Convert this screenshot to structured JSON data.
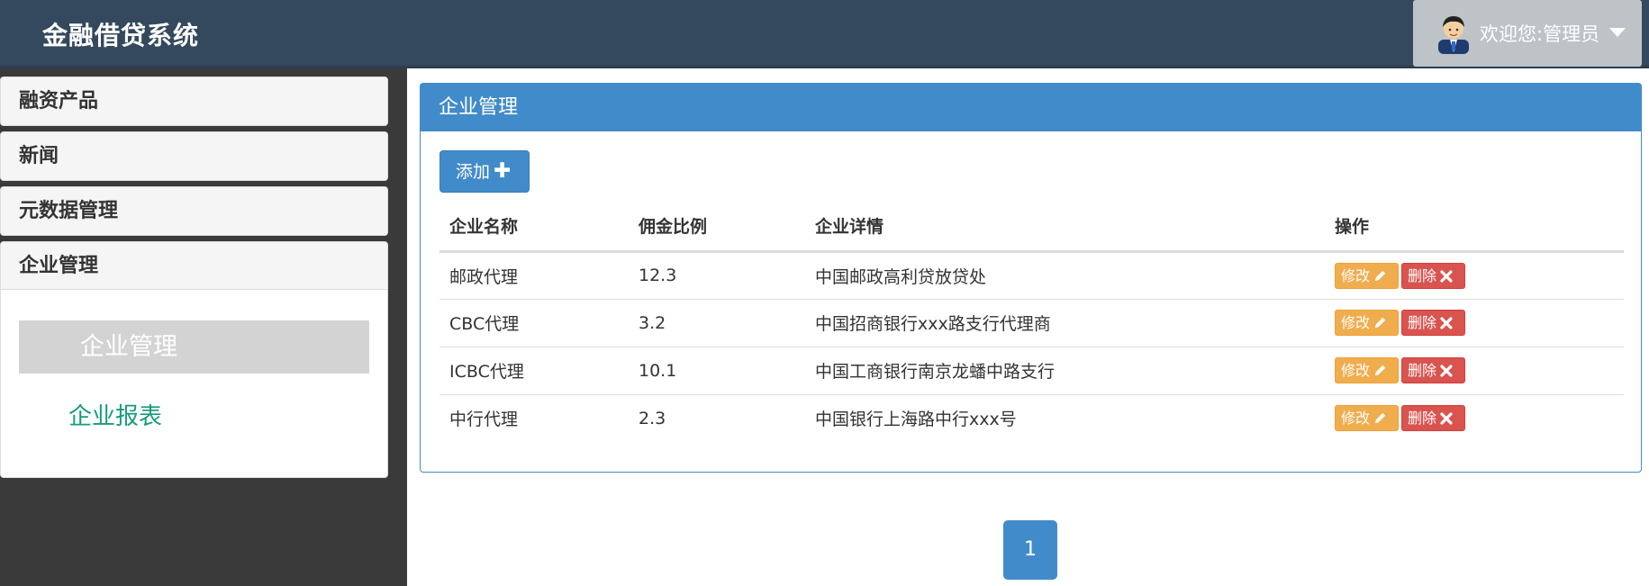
{
  "header": {
    "brand": "金融借贷系统",
    "welcome": "欢迎您:管理员"
  },
  "sidebar": {
    "groups": [
      {
        "label": "融资产品"
      },
      {
        "label": "新闻"
      },
      {
        "label": "元数据管理"
      },
      {
        "label": "企业管理"
      }
    ],
    "sub_items": [
      {
        "label": "企业管理"
      },
      {
        "label": "企业报表"
      }
    ]
  },
  "panel": {
    "title": "企业管理",
    "add_label": "添加",
    "columns": [
      "企业名称",
      "佣金比例",
      "企业详情",
      "操作"
    ],
    "rows": [
      {
        "name": "邮政代理",
        "commission": "12.3",
        "detail": "中国邮政高利贷放贷处"
      },
      {
        "name": "CBC代理",
        "commission": "3.2",
        "detail": "中国招商银行xxx路支行代理商"
      },
      {
        "name": "ICBC代理",
        "commission": "10.1",
        "detail": "中国工商银行南京龙蟠中路支行"
      },
      {
        "name": "中行代理",
        "commission": "2.3",
        "detail": "中国银行上海路中行xxx号"
      }
    ],
    "edit_label": "修改",
    "delete_label": "删除"
  },
  "pagination": {
    "current": "1"
  },
  "colors": {
    "header_bg": "#34495e",
    "primary": "#428bca",
    "warning": "#f0ad4e",
    "danger": "#d9534f",
    "link_green": "#179b7c"
  },
  "icons": {
    "avatar": "user-avatar-icon",
    "caret": "caret-down-icon",
    "add": "plus-icon",
    "edit": "pencil-icon",
    "delete": "times-icon"
  }
}
